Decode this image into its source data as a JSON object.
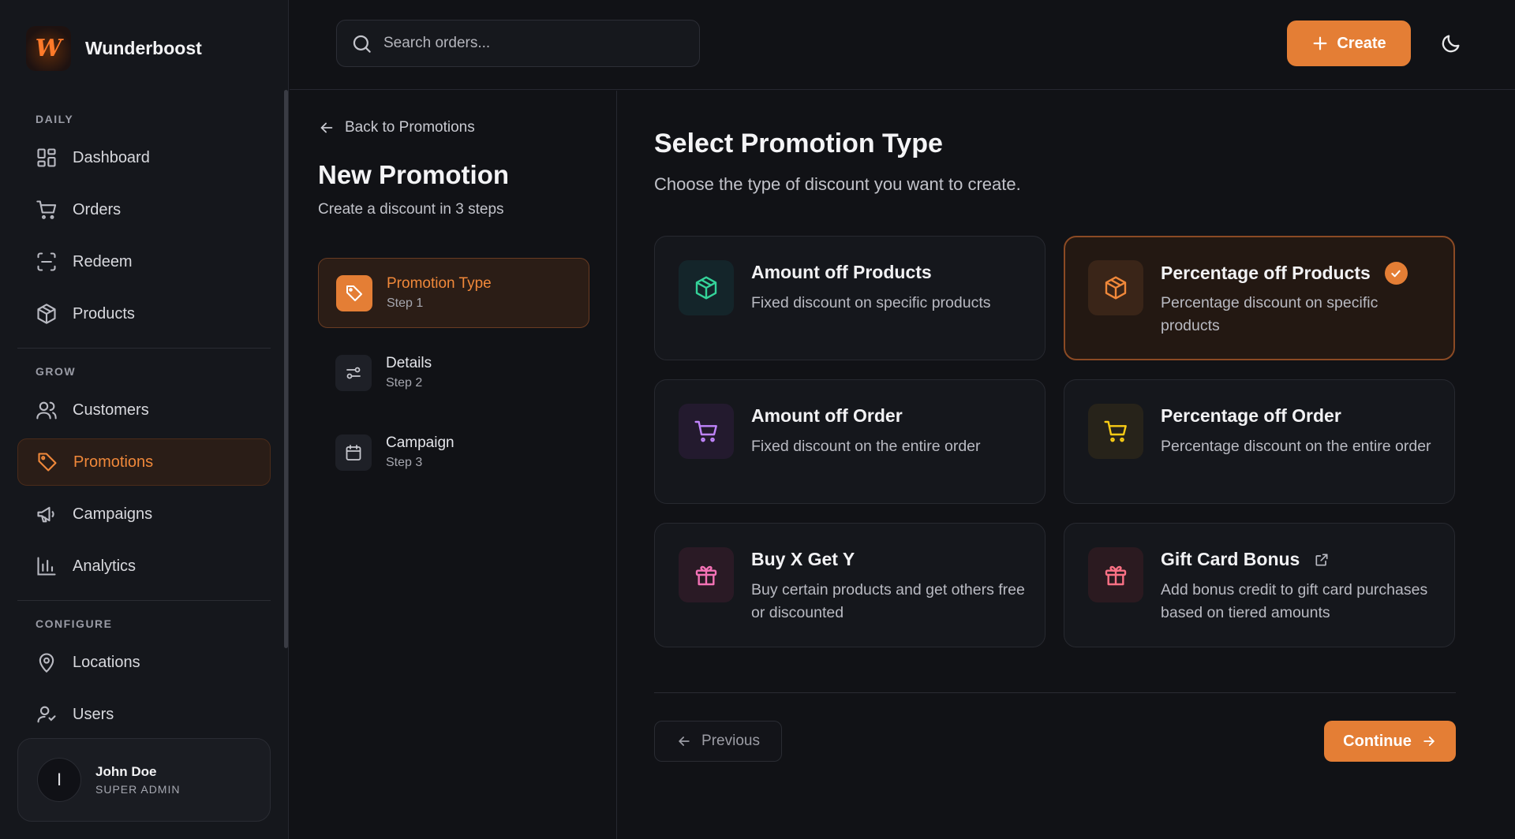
{
  "brand": {
    "name": "Wunderboost",
    "logo_letter": "W"
  },
  "sidebar": {
    "sections": {
      "daily": "DAILY",
      "grow": "GROW",
      "configure": "CONFIGURE"
    },
    "items": [
      {
        "label": "Dashboard",
        "icon": "dashboard-icon"
      },
      {
        "label": "Orders",
        "icon": "cart-icon"
      },
      {
        "label": "Redeem",
        "icon": "scan-icon"
      },
      {
        "label": "Products",
        "icon": "box-icon"
      },
      {
        "label": "Customers",
        "icon": "users-icon"
      },
      {
        "label": "Promotions",
        "icon": "tag-icon",
        "active": true
      },
      {
        "label": "Campaigns",
        "icon": "megaphone-icon"
      },
      {
        "label": "Analytics",
        "icon": "bar-chart-icon"
      },
      {
        "label": "Locations",
        "icon": "map-pin-icon"
      },
      {
        "label": "Users",
        "icon": "user-icon"
      }
    ],
    "user": {
      "initial": "I",
      "name": "John Doe",
      "role": "SUPER ADMIN"
    }
  },
  "topbar": {
    "search_placeholder": "Search orders...",
    "create_label": "Create"
  },
  "steps_panel": {
    "back_label": "Back to Promotions",
    "title": "New Promotion",
    "subtitle": "Create a discount in 3 steps",
    "steps": [
      {
        "label": "Promotion Type",
        "num": "Step 1",
        "active": true
      },
      {
        "label": "Details",
        "num": "Step 2"
      },
      {
        "label": "Campaign",
        "num": "Step 3"
      }
    ]
  },
  "main": {
    "title": "Select Promotion Type",
    "subtitle": "Choose the type of discount you want to create.",
    "cards": [
      {
        "title": "Amount off Products",
        "desc": "Fixed discount on specific products",
        "icon": "box-icon",
        "color": "#34d399",
        "bg": "#14252a"
      },
      {
        "title": "Percentage off Products",
        "desc": "Percentage discount on specific products",
        "icon": "box-icon",
        "color": "#f0883a",
        "bg": "#3a2518",
        "selected": true
      },
      {
        "title": "Amount off Order",
        "desc": "Fixed discount on the entire order",
        "icon": "cart-icon",
        "color": "#c084fc",
        "bg": "#231a2e"
      },
      {
        "title": "Percentage off Order",
        "desc": "Percentage discount on the entire order",
        "icon": "cart-icon",
        "color": "#facc15",
        "bg": "#27231a"
      },
      {
        "title": "Buy X Get Y",
        "desc": "Buy certain products and get others free or discounted",
        "icon": "gift-icon",
        "color": "#f472b6",
        "bg": "#2a1a25"
      },
      {
        "title": "Gift Card Bonus",
        "desc": "Add bonus credit to gift card purchases based on tiered amounts",
        "icon": "gift-icon",
        "color": "#fb7185",
        "bg": "#2b1a20"
      }
    ],
    "previous_label": "Previous",
    "continue_label": "Continue"
  },
  "colors": {
    "accent": "#e47e35",
    "background": "#111216",
    "panel": "#15171c"
  }
}
